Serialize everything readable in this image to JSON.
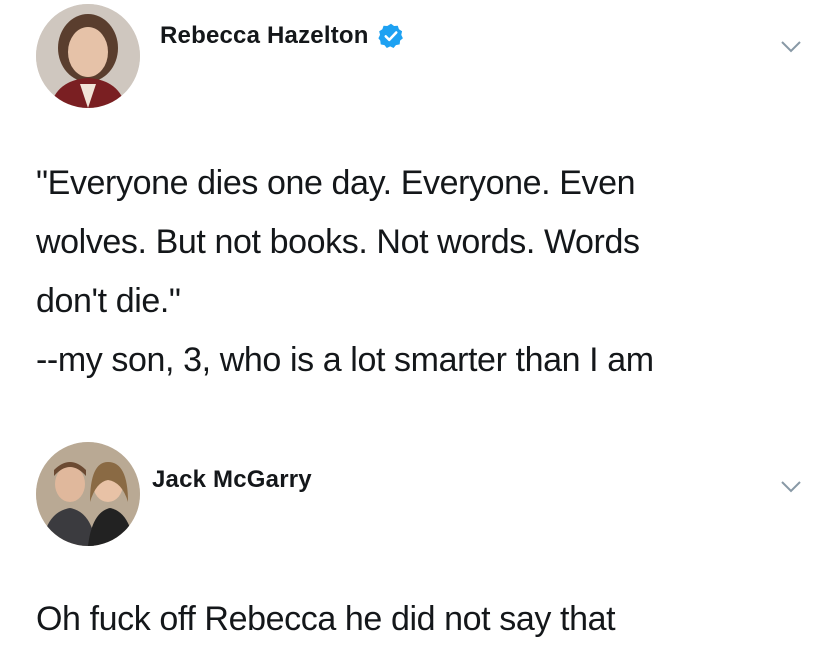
{
  "tweets": [
    {
      "author": "Rebecca Hazelton",
      "verified": true,
      "icons": {
        "avatar": "avatar-photo",
        "badge": "verified-badge-icon",
        "menu": "chevron-down-icon"
      },
      "text_lines": [
        "\"Everyone dies one day. Everyone. Even",
        "wolves. But not books. Not words. Words",
        "don't die.\"",
        "--my son, 3, who is a lot smarter than I am"
      ]
    },
    {
      "author": "Jack McGarry",
      "verified": false,
      "icons": {
        "avatar": "avatar-photo",
        "menu": "chevron-down-icon"
      },
      "text_lines": [
        "Oh fuck off Rebecca he did not say that"
      ]
    }
  ],
  "colors": {
    "text": "#14171a",
    "verified_blue": "#1da1f2",
    "chevron": "#8899a6"
  }
}
